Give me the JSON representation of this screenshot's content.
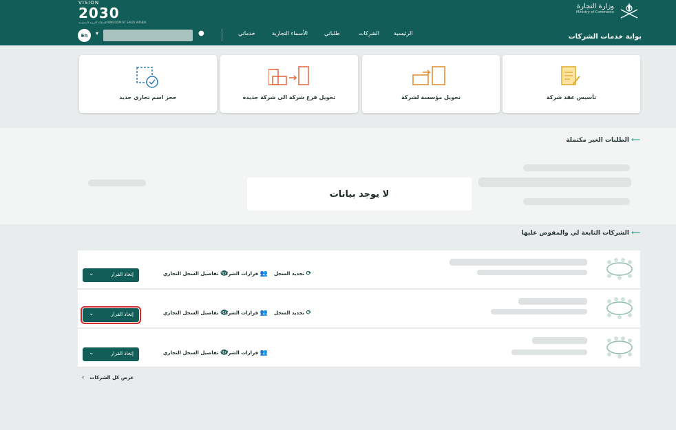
{
  "header": {
    "vision_top": "VISION",
    "vision_year": "2030",
    "vision_small": "المملكة العربية السعودية KINGDOM OF SAUDI ARABIA",
    "ministry_ar": "وزارة التجارة",
    "ministry_en": "Ministry of Commerce",
    "portal_title": "بوابة خدمات الشركات",
    "lang_label": "En",
    "nav": [
      "الرئيسية",
      "الشركات",
      "طلباتي",
      "الأسماء التجارية",
      "خدماتي"
    ]
  },
  "services": [
    {
      "label": "تأسيس عقد شركة",
      "icon": "contract-icon"
    },
    {
      "label": "تحويل مؤسسة لشركة",
      "icon": "convert-establishment-icon"
    },
    {
      "label": "تحويل فرع شركة الى شركة جديدة",
      "icon": "convert-branch-icon"
    },
    {
      "label": "حجز اسم تجاري جديد",
      "icon": "reserve-name-icon"
    }
  ],
  "incomplete": {
    "title": "الطلبات الغير مكتملة",
    "empty_text": "لا يوجد بيانات"
  },
  "companies": {
    "title": "الشركات التابعة لي والمفوض عليها",
    "rows": [
      {
        "renew": "تجديد السجل",
        "partners": "قرارات الشركاء",
        "details": "تفاصيل السجل التجاري",
        "decision": "إتخاذ القرار"
      },
      {
        "renew": "تجديد السجل",
        "partners": "قرارات الشركاء",
        "details": "تفاصيل السجل التجاري",
        "decision": "إتخاذ القرار"
      },
      {
        "partners": "قرارات الشركاء",
        "details": "تفاصيل السجل التجاري",
        "decision": "إتخاذ القرار"
      }
    ],
    "show_all": "عرض كل الشركات"
  },
  "colors": {
    "primary": "#125d57",
    "accent": "#2a9a89",
    "highlight": "#d32a2a"
  }
}
